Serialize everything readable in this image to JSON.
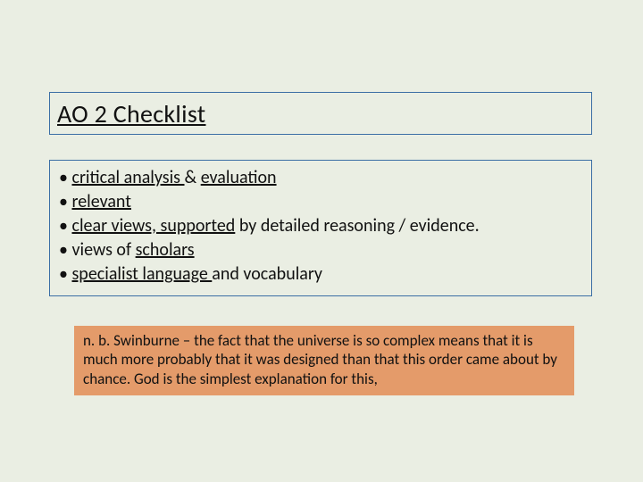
{
  "title": "AO 2 Checklist",
  "bullets": {
    "b0": {
      "s0": "critical analysis ",
      "amp": "& ",
      "s1": "evaluation"
    },
    "b1": "relevant",
    "b2": {
      "s0": "clear views,",
      "s1": " supported",
      "s2": " by detailed reasoning / evidence."
    },
    "b3": {
      "s0": "views of ",
      "s1": "scholars"
    },
    "b4": {
      "s0": "specialist language ",
      "s1": "and vocabulary"
    }
  },
  "note": "n. b. Swinburne – the fact that the universe is so complex means that it is much more probably that it was designed than that this order came about by chance. God is the simplest explanation for this,",
  "glyphs": {
    "bullet": "• "
  }
}
